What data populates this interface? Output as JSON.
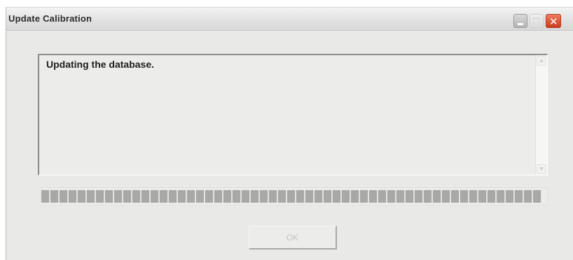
{
  "window": {
    "title": "Update Calibration"
  },
  "title_buttons": {
    "minimize": "minimize-icon",
    "maximize": "maximize-icon",
    "close": "close-icon"
  },
  "message_box": {
    "text": "Updating the database."
  },
  "progress": {
    "fraction_filled": 0.99,
    "state": "in-progress"
  },
  "buttons": {
    "ok_label": "OK",
    "ok_enabled": false
  },
  "colors": {
    "window_background": "#e9e9e7",
    "close_button": "#d84a2a",
    "progress_segment": "#a8a8a6"
  }
}
